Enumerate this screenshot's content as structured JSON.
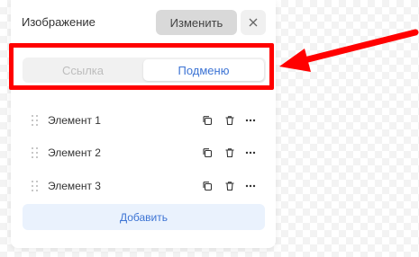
{
  "header": {
    "label": "Изображение",
    "change_label": "Изменить"
  },
  "tabs": [
    {
      "label": "Ссылка",
      "active": false
    },
    {
      "label": "Подменю",
      "active": true
    }
  ],
  "items": [
    {
      "label": "Элемент 1"
    },
    {
      "label": "Элемент 2"
    },
    {
      "label": "Элемент 3"
    }
  ],
  "add_label": "Добавить",
  "colors": {
    "accent": "#3d74d4",
    "highlight": "#ff0000",
    "add_bg": "#eaf2fd"
  },
  "icons": [
    "close-icon",
    "drag-handle-icon",
    "copy-icon",
    "trash-icon",
    "more-icon",
    "arrow-icon"
  ]
}
